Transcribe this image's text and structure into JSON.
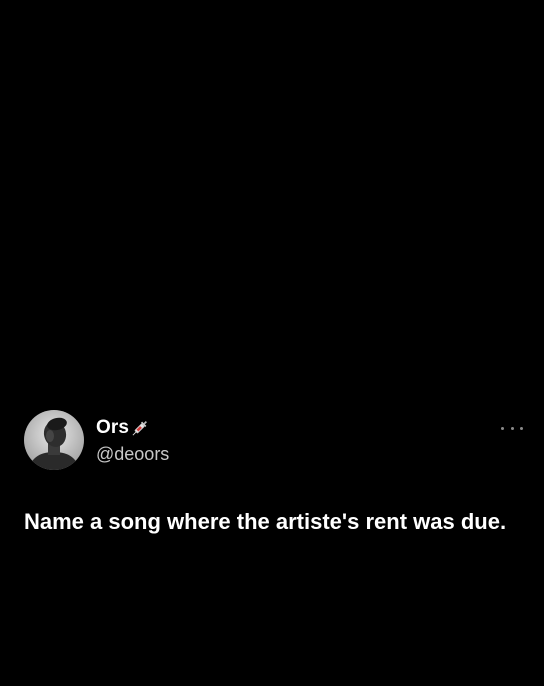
{
  "tweet": {
    "author": {
      "display_name": "Ors",
      "name_emoji": "syringe-icon",
      "handle": "@deoors",
      "avatar": "profile-photo-grayscale"
    },
    "text": "Name a song where the artiste's rent was due.",
    "more_menu_icon": "more-horizontal-icon"
  },
  "colors": {
    "background": "#000000",
    "text_primary": "#ffffff",
    "text_secondary": "#c8c8c8",
    "icon_muted": "#8a8a8a"
  }
}
